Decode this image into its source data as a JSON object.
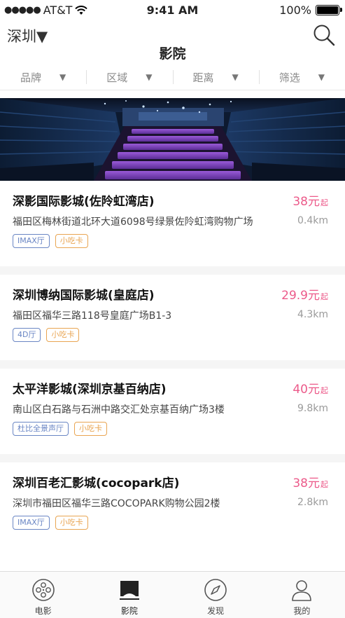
{
  "status": {
    "carrier": "AT&T",
    "time": "9:41 AM",
    "battery": "100%"
  },
  "header": {
    "city": "深圳▼",
    "title": "影院"
  },
  "filters": [
    {
      "label": "品牌"
    },
    {
      "label": "区域"
    },
    {
      "label": "距离"
    },
    {
      "label": "筛选"
    }
  ],
  "cinemas": [
    {
      "name": "深影国际影城(佐阾虹湾店)",
      "price": "38元",
      "price_suffix": "起",
      "address": "福田区梅林街道北环大道6098号绿景佐阾虹湾购物广场",
      "distance": "0.4km",
      "tags": [
        "IMAX厅",
        "小吃卡"
      ]
    },
    {
      "name": "深圳博纳国际影城(皇庭店)",
      "price": "29.9元",
      "price_suffix": "起",
      "address": "福田区福华三路118号皇庭广场B1-3",
      "distance": "4.3km",
      "tags": [
        "4D厅",
        "小吃卡"
      ]
    },
    {
      "name": "太平洋影城(深圳京基百纳店)",
      "price": "40元",
      "price_suffix": "起",
      "address": "南山区白石路与石洲中路交汇处京基百纳广场3楼",
      "distance": "9.8km",
      "tags": [
        "杜比全景声厅",
        "小吃卡"
      ]
    },
    {
      "name": "深圳百老汇影城(cocopark店)",
      "price": "38元",
      "price_suffix": "起",
      "address": "深圳市福田区福华三路COCOPARK购物公园2楼",
      "distance": "2.8km",
      "tags": [
        "IMAX厅",
        "小吃卡"
      ]
    }
  ],
  "tabbar": [
    {
      "label": "电影"
    },
    {
      "label": "影院"
    },
    {
      "label": "发现"
    },
    {
      "label": "我的"
    }
  ],
  "colors": {
    "accent_price": "#ec5a8a",
    "tag_blue": "#6a86c4",
    "tag_orange": "#e9a552"
  }
}
